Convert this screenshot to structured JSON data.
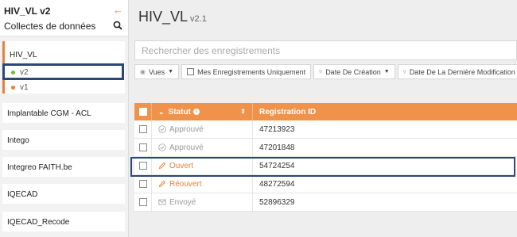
{
  "sidebar": {
    "title": "HIV_VL v2",
    "subtitle": "Collectes de données",
    "active_project": "HIV_VL",
    "versions": [
      {
        "label": "v2",
        "color": "#7ab833"
      },
      {
        "label": "v1",
        "color": "#e8803a"
      }
    ],
    "projects": [
      "Implantable CGM - ACL",
      "Intego",
      "Integreo FAITH.be",
      "IQECAD",
      "IQECAD_Recode"
    ]
  },
  "main": {
    "title": "HIV_VL",
    "version": "v2.1",
    "search_placeholder": "Rechercher des enregistrements",
    "filters": {
      "views": "Vues",
      "my_records": "Mes Enregistrements Uniquement",
      "created": "Date De Création",
      "modified": "Date De La Dernière Modification"
    },
    "table": {
      "headers": {
        "status": "Statut",
        "registration": "Registration ID"
      },
      "rows": [
        {
          "status": "Approuvé",
          "status_type": "approved",
          "id": "47213923"
        },
        {
          "status": "Approuvé",
          "status_type": "approved",
          "id": "47201848"
        },
        {
          "status": "Ouvert",
          "status_type": "open",
          "id": "54724254"
        },
        {
          "status": "Réouvert",
          "status_type": "open",
          "id": "48272594"
        },
        {
          "status": "Envoyé",
          "status_type": "sent",
          "id": "52896329"
        }
      ]
    }
  },
  "colors": {
    "accent": "#e8803a",
    "header": "#f0924a",
    "highlight": "#2b4776",
    "green": "#7ab833"
  }
}
